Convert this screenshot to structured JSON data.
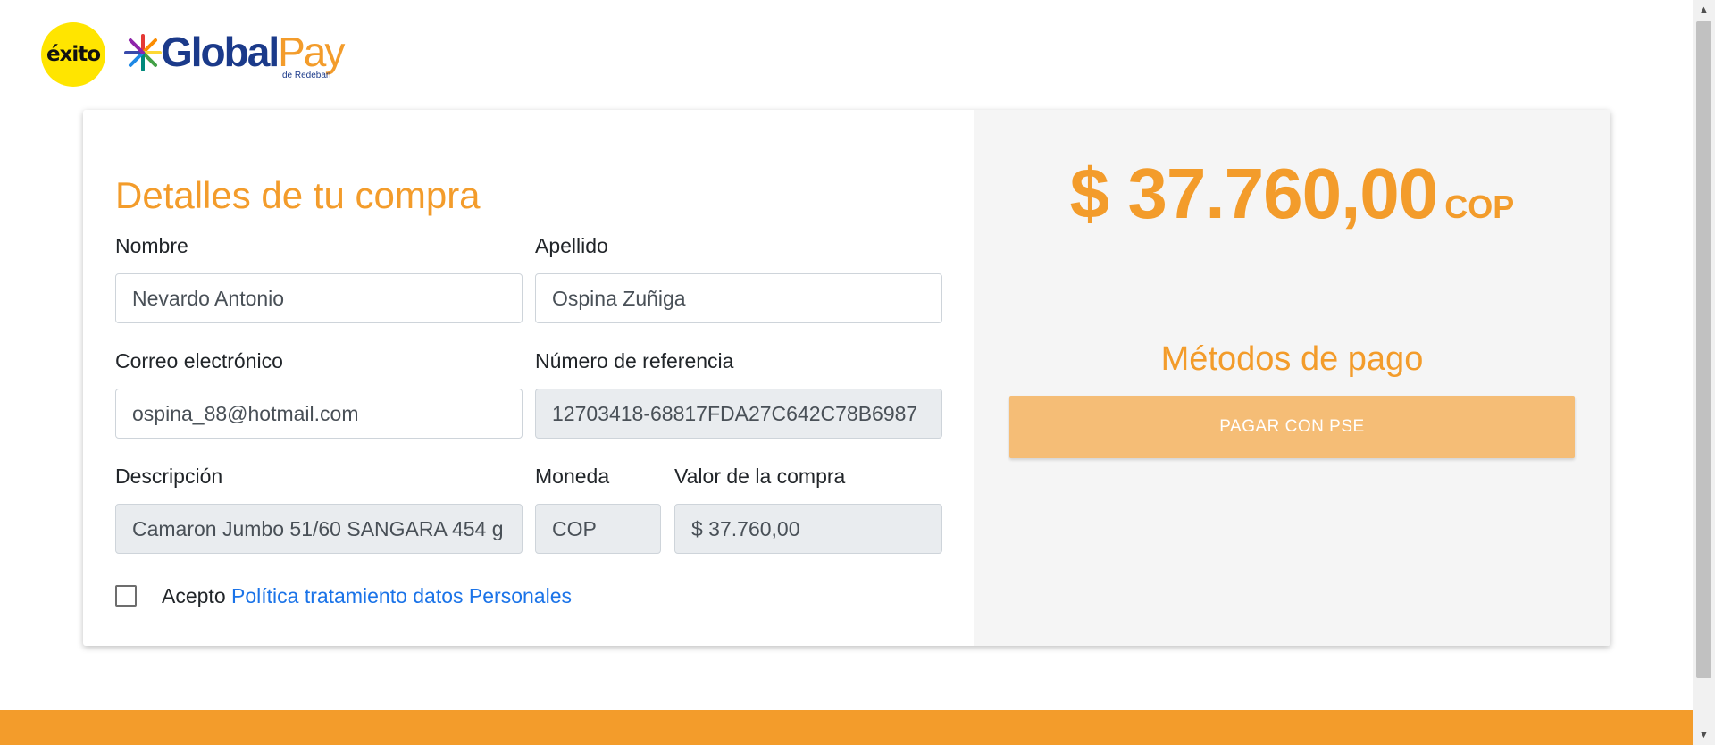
{
  "header": {
    "exito_logo_text": "éxito",
    "globalpay_part1": "Global",
    "globalpay_part2": "Pay",
    "globalpay_sub": "de Redeban"
  },
  "form": {
    "title": "Detalles de tu compra",
    "nombre_label": "Nombre",
    "nombre_value": "Nevardo Antonio",
    "apellido_label": "Apellido",
    "apellido_value": "Ospina Zuñiga",
    "correo_label": "Correo electrónico",
    "correo_value": "ospina_88@hotmail.com",
    "referencia_label": "Número de referencia",
    "referencia_value": "12703418-68817FDA27C642C78B6987",
    "descripcion_label": "Descripción",
    "descripcion_value": "Camaron Jumbo 51/60 SANGARA 454 g",
    "moneda_label": "Moneda",
    "moneda_value": "COP",
    "valor_label": "Valor de la compra",
    "valor_value": "$ 37.760,00",
    "accept_text": "Acepto",
    "policy_link": "Política tratamiento datos Personales",
    "accept_checked": false
  },
  "summary": {
    "amount": "$ 37.760,00",
    "currency": "COP",
    "methods_title": "Métodos de pago",
    "pse_button": "PAGAR CON PSE"
  },
  "colors": {
    "accent": "#f39c2b",
    "button_bg": "#f5bd76",
    "link": "#1a73e8",
    "panel_bg": "#f5f5f5"
  }
}
